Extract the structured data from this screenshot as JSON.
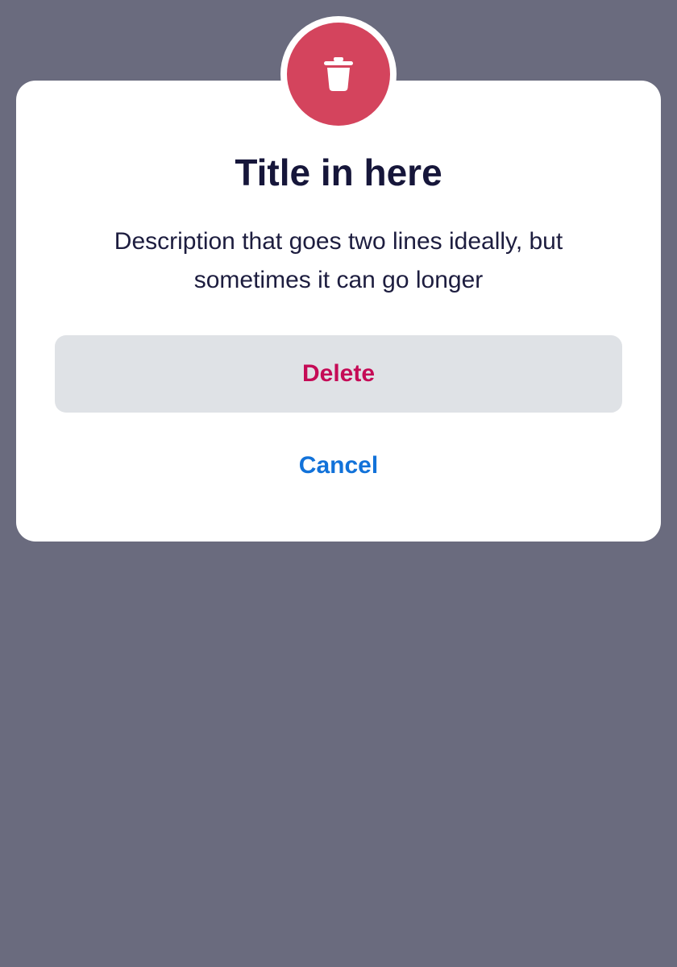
{
  "colors": {
    "backdrop": "#6a6b7e",
    "dialog_background": "#ffffff",
    "icon_circle": "#d4445d",
    "title_text": "#16163a",
    "delete_text": "#c50b56",
    "delete_background": "#dfe2e6",
    "cancel_text": "#1272d9"
  },
  "dialog": {
    "icon": "trash-icon",
    "title": "Title in here",
    "description": "Description that goes two lines ideally, but sometimes it can go longer",
    "actions": {
      "delete_label": "Delete",
      "cancel_label": "Cancel"
    }
  }
}
